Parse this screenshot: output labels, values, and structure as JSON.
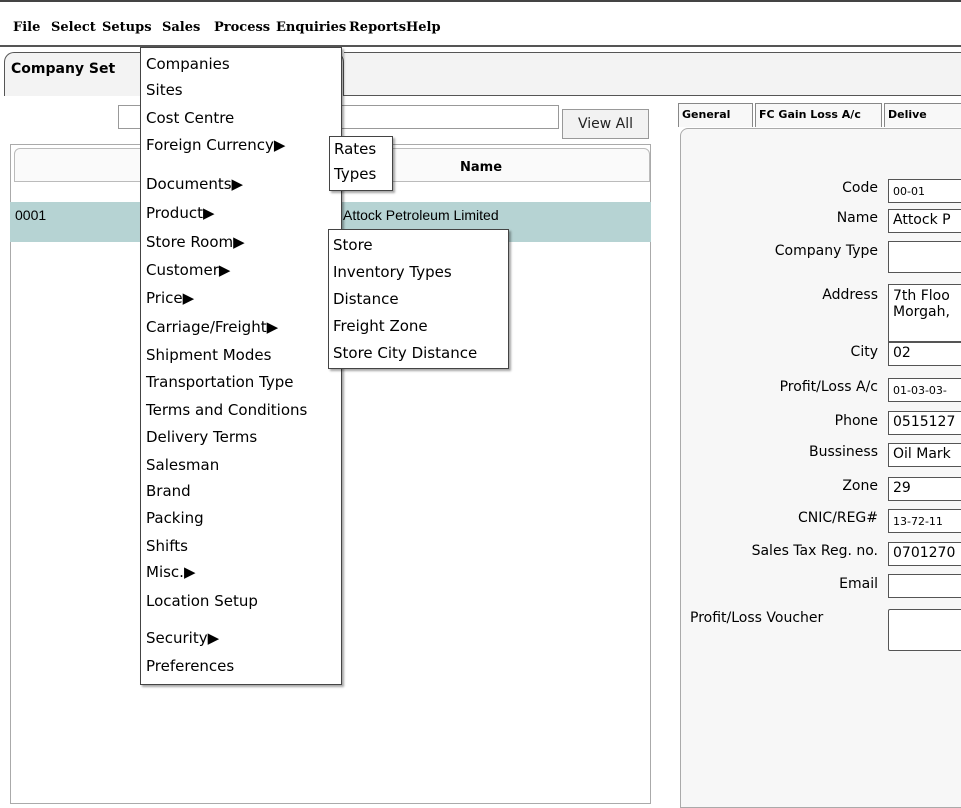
{
  "menubar": {
    "items": [
      "File",
      "Select",
      "Setups",
      "Sales",
      "Process",
      "Enquiries",
      "Reports",
      "Help"
    ]
  },
  "page_tab": {
    "label": "Company Set"
  },
  "list": {
    "view_all_label": "View All",
    "name_header": "Name",
    "rows": [
      {
        "code": "0001",
        "name": "Attock Petroleum Limited"
      }
    ]
  },
  "setups_menu": {
    "items": [
      "Companies",
      "Sites",
      "Cost Centre",
      "Foreign Currency▶",
      "Documents▶",
      "Product▶",
      "Store Room▶",
      "Customer▶",
      "Price▶",
      "Carriage/Freight▶",
      "Shipment Modes",
      "Transportation Type",
      "Terms and Conditions",
      "Delivery Terms",
      "Salesman",
      "Brand",
      "Packing",
      "Shifts",
      "Misc.▶",
      "Location Setup",
      "Security▶",
      "Preferences"
    ]
  },
  "currency_submenu": {
    "items": [
      "Rates",
      "Types"
    ]
  },
  "storeroom_submenu": {
    "items": [
      "Store",
      "Inventory Types",
      "Distance",
      "Freight Zone",
      "Store City Distance"
    ]
  },
  "form": {
    "tabs": [
      "General",
      "FC Gain Loss A/c",
      "Delive"
    ],
    "fields": {
      "code": {
        "label": "Code",
        "value": "00-01"
      },
      "name": {
        "label": "Name",
        "value": "Attock P"
      },
      "company_type": {
        "label": "Company Type",
        "value": ""
      },
      "address": {
        "label": "Address",
        "value_line1": "7th Floo",
        "value_line2": "Morgah,"
      },
      "city": {
        "label": "City",
        "value": "02"
      },
      "profit_loss_ac": {
        "label": "Profit/Loss A/c",
        "value": "01-03-03-"
      },
      "phone": {
        "label": "Phone",
        "value": "0515127"
      },
      "bussiness": {
        "label": "Bussiness",
        "value": "Oil Mark"
      },
      "zone": {
        "label": "Zone",
        "value": "29"
      },
      "cnic": {
        "label": "CNIC/REG#",
        "value": "13-72-11"
      },
      "sales_tax": {
        "label": "Sales Tax Reg. no.",
        "value": "0701270"
      },
      "email": {
        "label": "Email",
        "value": ""
      },
      "pl_voucher": {
        "label": "Profit/Loss Voucher"
      }
    }
  }
}
